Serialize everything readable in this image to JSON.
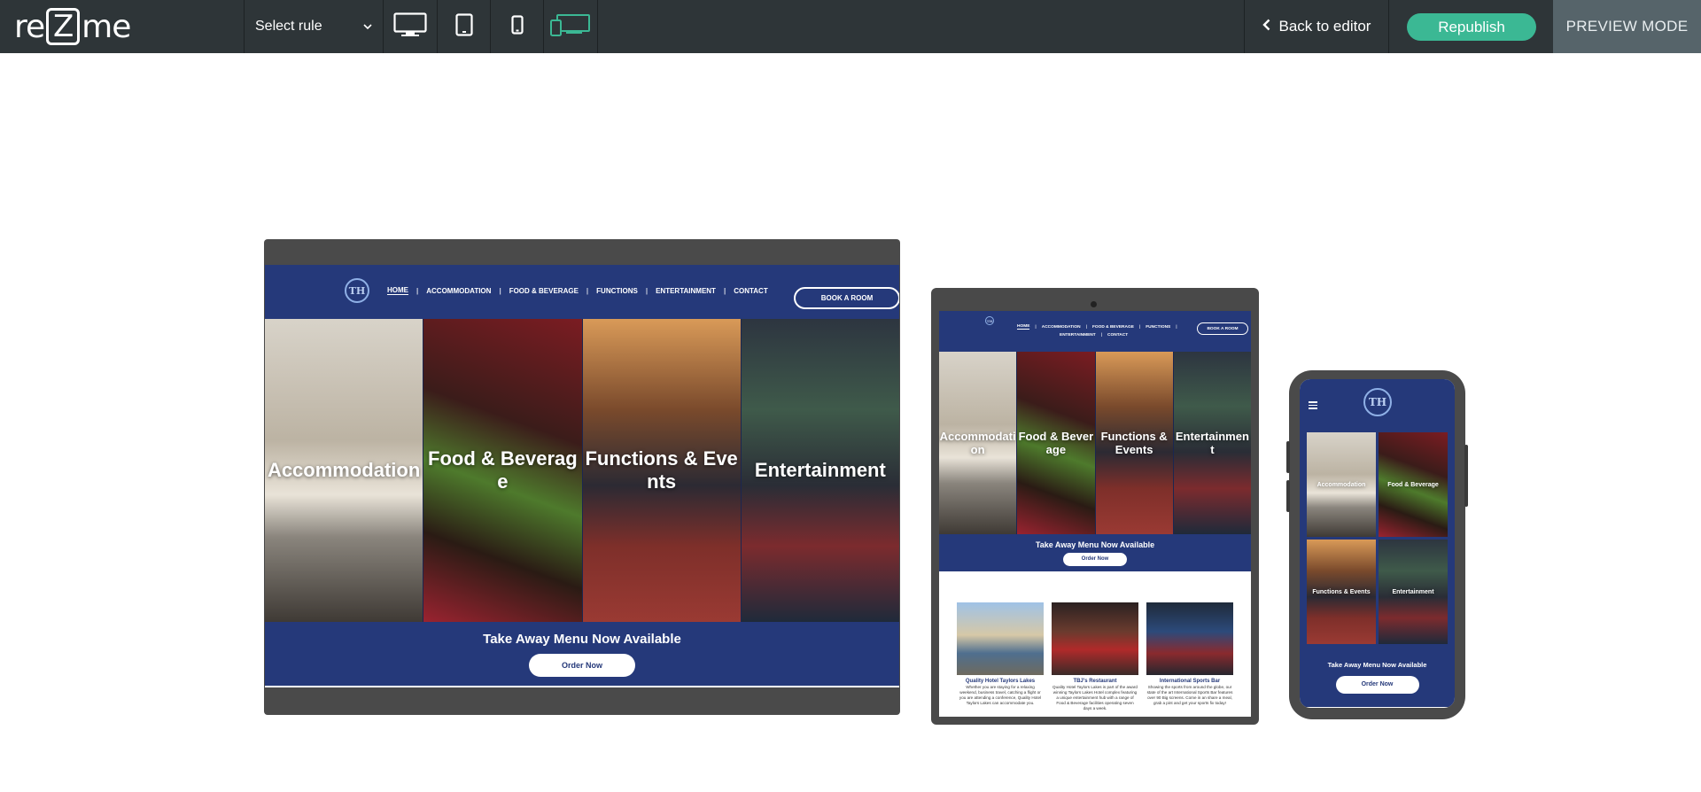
{
  "toolbar": {
    "logo_pre": "re",
    "logo_z": "Z",
    "logo_post": "me",
    "rule_select": "Select rule",
    "devices": [
      "desktop-icon",
      "tablet-icon",
      "phone-icon",
      "all-devices-icon"
    ],
    "active_device": "all-devices-icon",
    "back_label": "Back to editor",
    "republish_label": "Republish",
    "preview_mode_label": "PREVIEW MODE"
  },
  "colors": {
    "toolbar_bg": "#2e3538",
    "republish": "#3bb894",
    "preview_mode_bg": "#56646a",
    "site_blue": "#25397a",
    "device_frame": "#4a4a4a",
    "active_device": "#3bb894"
  },
  "site": {
    "logo": "TH",
    "nav": [
      "HOME",
      "ACCOMMODATION",
      "FOOD & BEVERAGE",
      "FUNCTIONS",
      "ENTERTAINMENT",
      "CONTACT"
    ],
    "book_label": "BOOK A ROOM",
    "tiles": [
      "Accommodation",
      "Food & Beverage",
      "Functions & Events",
      "Entertainment"
    ],
    "promo_title": "Take Away Menu Now Available",
    "order_label": "Order Now",
    "cards": [
      {
        "title": "Quality Hotel Taylors Lakes",
        "desc": "Whether you are staying for a relaxing weekend, business travel, catching a flight or you are attending a conference, Quality Hotel Taylors Lakes can accommodate you."
      },
      {
        "title": "TBJ's Restaurant",
        "desc": "Quality Hotel Taylors Lakes is part of the award winning Taylors Lakes Hotel complex featuring a unique entertainment hub with a range of Food & Beverage facilities operating seven days a week."
      },
      {
        "title": "International Sports Bar",
        "desc": "Showing the sports from around the globe, our state of the art International Sports Bar features over 90 Big screens. Come in an share a meal, grab a pint and get your sports fix today!"
      }
    ]
  }
}
